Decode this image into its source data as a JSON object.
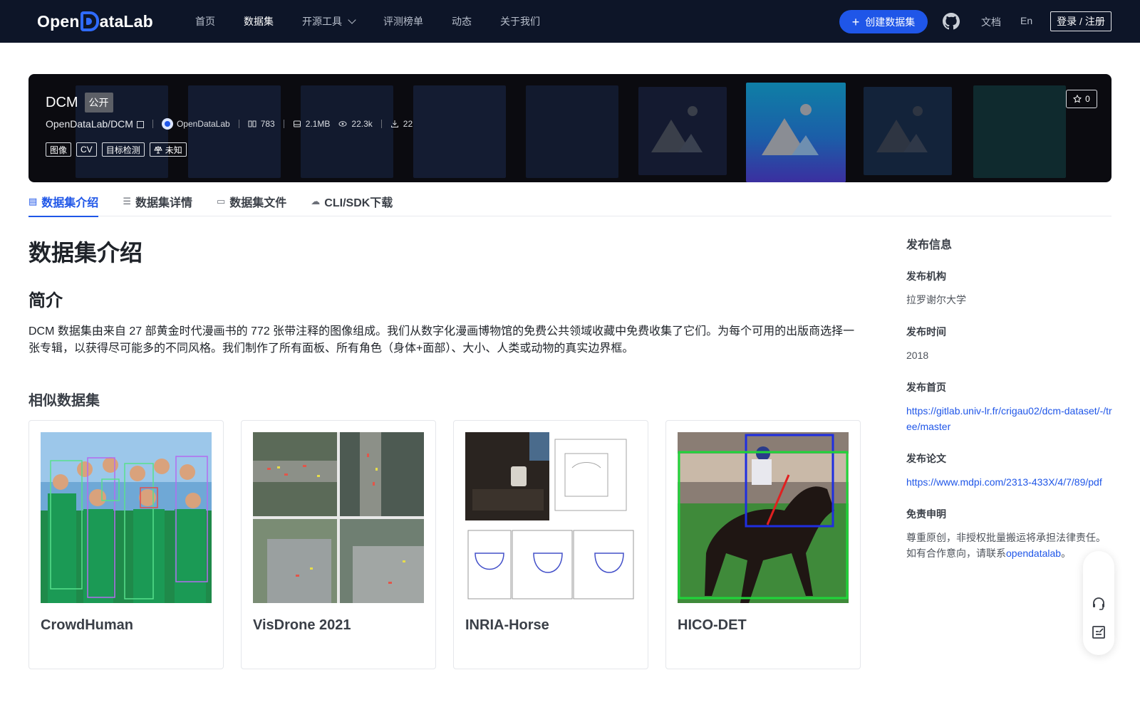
{
  "nav": {
    "logo": {
      "part1": "Open",
      "part2": "ataLab"
    },
    "links": [
      {
        "label": "首页",
        "active": false
      },
      {
        "label": "数据集",
        "active": true
      },
      {
        "label": "开源工具",
        "active": false,
        "dropdown": true
      },
      {
        "label": "评测榜单",
        "active": false
      },
      {
        "label": "动态",
        "active": false
      },
      {
        "label": "关于我们",
        "active": false
      }
    ],
    "create_label": "创建数据集",
    "github_icon": "github-icon",
    "docs_label": "文档",
    "lang_label": "En",
    "login_label": "登录 / 注册"
  },
  "dataset": {
    "name": "DCM",
    "visibility": "公开",
    "path": "OpenDataLab/DCM",
    "org": "OpenDataLab",
    "file_count": "783",
    "size": "2.1MB",
    "views": "22.3k",
    "downloads": "22",
    "tags": [
      "图像",
      "CV",
      "目标检测"
    ],
    "license": "未知",
    "stars": "0"
  },
  "tabs": [
    {
      "label": "数据集介绍",
      "icon": "database-icon",
      "active": true
    },
    {
      "label": "数据集详情",
      "icon": "list-icon",
      "active": false
    },
    {
      "label": "数据集文件",
      "icon": "file-icon",
      "active": false
    },
    {
      "label": "CLI/SDK下载",
      "icon": "cloud-download-icon",
      "active": false
    }
  ],
  "main": {
    "title": "数据集介绍",
    "intro_heading": "简介",
    "description": "DCM 数据集由来自 27 部黄金时代漫画书的 772 张带注释的图像组成。我们从数字化漫画博物馆的免费公共领域收藏中免费收集了它们。为每个可用的出版商选择一张专辑，以获得尽可能多的不同风格。我们制作了所有面板、所有角色（身体+面部）、大小、人类或动物的真实边界框。",
    "similar_heading": "相似数据集",
    "similar": [
      {
        "name": "CrowdHuman"
      },
      {
        "name": "VisDrone 2021"
      },
      {
        "name": "INRIA-Horse"
      },
      {
        "name": "HICO-DET"
      }
    ]
  },
  "sidebar": {
    "title": "发布信息",
    "org_label": "发布机构",
    "org_value": "拉罗谢尔大学",
    "time_label": "发布时间",
    "time_value": "2018",
    "home_label": "发布首页",
    "home_value": "https://gitlab.univ-lr.fr/crigau02/dcm-dataset/-/tree/master",
    "paper_label": "发布论文",
    "paper_value": "https://www.mdpi.com/2313-433X/4/7/89/pdf",
    "disclaimer_label": "免责申明",
    "disclaimer_text": "尊重原创，非授权批量搬运将承担法律责任。如有合作意向，请联系",
    "disclaimer_link": "opendatalab",
    "disclaimer_end": "。"
  },
  "colors": {
    "accent": "#1f56e8",
    "nav_bg": "#0d1528",
    "banner_bg": "#0b0b10"
  }
}
